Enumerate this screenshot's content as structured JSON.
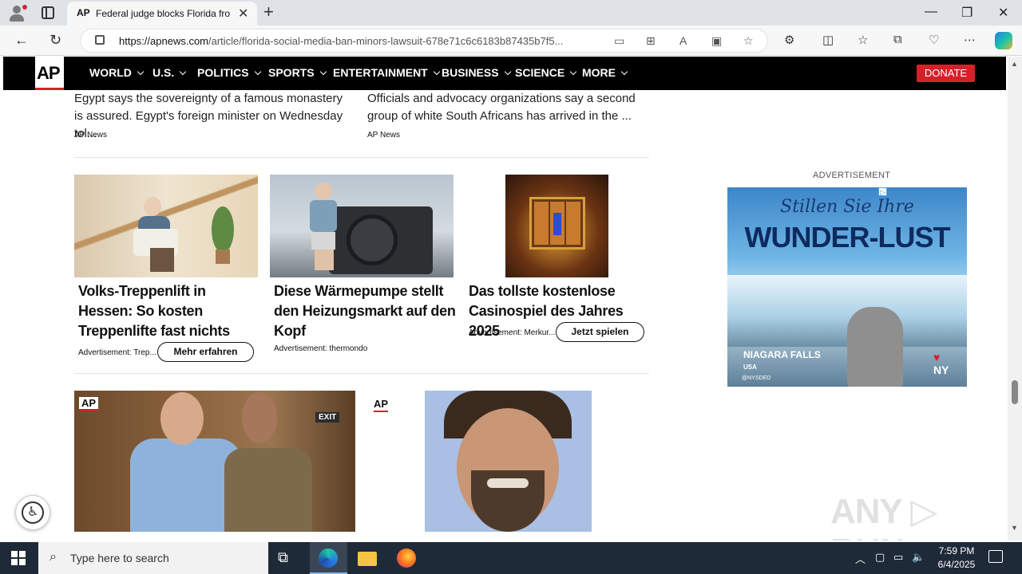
{
  "browser": {
    "tab_favicon": "AP",
    "tab_title": "Federal judge blocks Florida from",
    "url_domain": "https://apnews.com",
    "url_path": "/article/florida-social-media-ban-minors-lawsuit-678e71c6c6183b87435b7f5...",
    "new_tab": "+",
    "win_min": "—",
    "win_max": "❐",
    "win_close": "✕"
  },
  "ap_nav": {
    "logo": "AP",
    "items": [
      "WORLD",
      "U.S.",
      "POLITICS",
      "SPORTS",
      "ENTERTAINMENT",
      "BUSINESS",
      "SCIENCE",
      "MORE"
    ],
    "donate": "DONATE"
  },
  "stories": [
    {
      "text": "Egypt says the sovereignty of a famous monastery is assured. Egypt's foreign minister on Wednesday tol...",
      "source": "AP News"
    },
    {
      "text": "Officials and advocacy organizations say a second group of white South Africans has arrived in the ...",
      "source": "AP News"
    }
  ],
  "ads": [
    {
      "title": "Volks-Treppenlift in Hessen: So kosten Treppenlifte fast nichts",
      "meta": "Advertisement: Trep...",
      "button": "Mehr erfahren"
    },
    {
      "title": "Diese Wärmepumpe stellt den Heizungsmarkt auf den Kopf",
      "meta": "Advertisement: thermondo",
      "button": ""
    },
    {
      "title": "Das tollste kostenlose Casinospiel des Jahres 2025",
      "meta": "Advertisement: Merkur...",
      "button": "Jetzt spielen"
    }
  ],
  "sidebar_ad": {
    "label": "ADVERTISEMENT",
    "line1": "Stillen Sie Ihre",
    "line2": "WUNDER-LUST",
    "brand": "NIAGARA FALLS",
    "brand_sub": "USA",
    "ny": "NY",
    "credit": "@NYSDED"
  },
  "news_row": {
    "ap_badge_1": "AP",
    "ap_badge_2": "AP",
    "exit_sign": "EXIT"
  },
  "watermark": "ANY ▷ RUN",
  "taskbar": {
    "search_placeholder": "Type here to search",
    "time": "7:59 PM",
    "date": "6/4/2025"
  },
  "colors": {
    "ap_red": "#d5202a",
    "nav_bg": "#000000",
    "taskbar_bg": "#1f2a38"
  }
}
